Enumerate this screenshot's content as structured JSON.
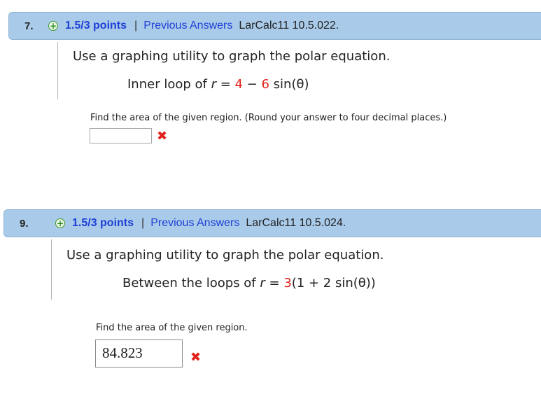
{
  "questions": [
    {
      "number": "7.",
      "points": "1.5/3 points",
      "separator": "|",
      "previous_answers": "Previous Answers",
      "source": "LarCalc11 10.5.022.",
      "prompt": "Use a graphing utility to graph the polar equation.",
      "equation": {
        "prefix": "Inner loop of ",
        "var": "r",
        "eq": " = ",
        "a": "4",
        "minus": " − ",
        "b": "6",
        "rest": " sin(θ)"
      },
      "instruction": "Find the area of the given region. (Round your answer to four decimal places.)",
      "answer_value": "",
      "status_icon": "incorrect-x"
    },
    {
      "number": "9.",
      "points": "1.5/3 points",
      "separator": "|",
      "previous_answers": "Previous Answers",
      "source": "LarCalc11 10.5.024.",
      "prompt": "Use a graphing utility to graph the polar equation.",
      "equation": {
        "prefix": "Between the loops of ",
        "var": "r",
        "eq": " = ",
        "a": "3",
        "rest": "(1 + 2 sin(θ))"
      },
      "instruction": "Find the area of the given region.",
      "answer_value": "84.823",
      "status_icon": "incorrect-x"
    }
  ],
  "colors": {
    "header_bg": "#a9cbe9",
    "link_blue": "#1e3fd6",
    "wrong_red": "#e0221c"
  }
}
